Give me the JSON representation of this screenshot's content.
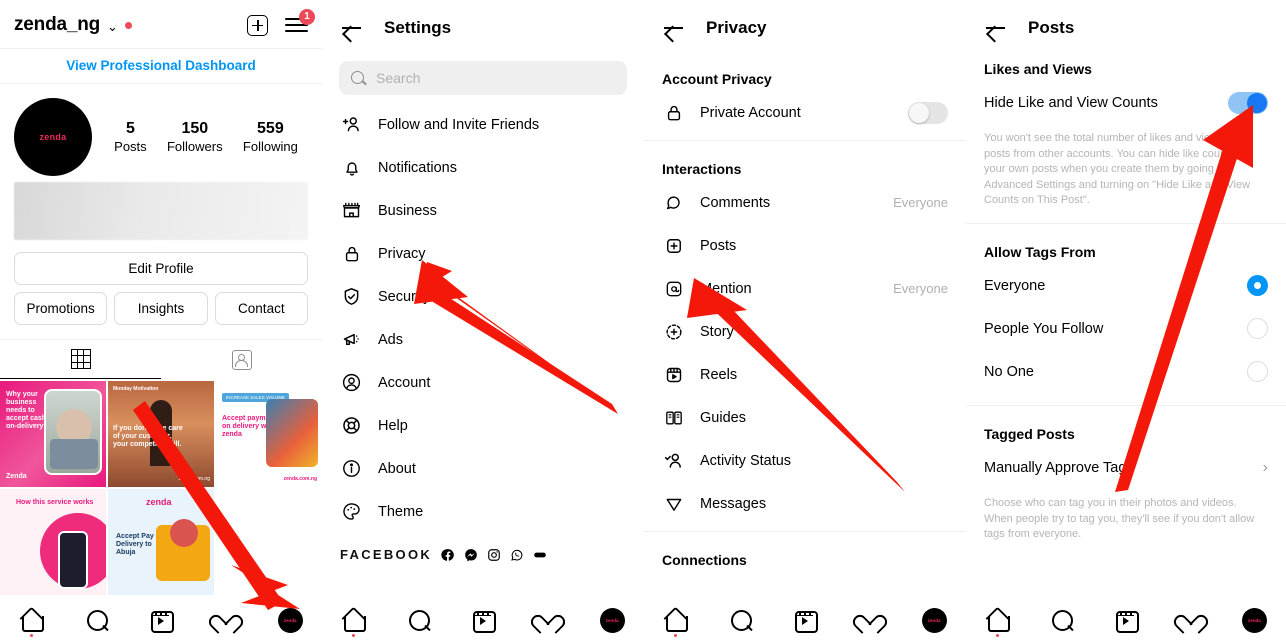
{
  "profile": {
    "username": "zenda_ng",
    "chevron": "⌄",
    "dashboard_link": "View Professional Dashboard",
    "avatar_text": "zenda",
    "notification_badge": "1",
    "stats": [
      {
        "num": "5",
        "label": "Posts"
      },
      {
        "num": "150",
        "label": "Followers"
      },
      {
        "num": "559",
        "label": "Following"
      }
    ],
    "edit_profile": "Edit Profile",
    "actions": [
      "Promotions",
      "Insights",
      "Contact"
    ],
    "photos": [
      {
        "title": "Why your business needs to accept cash-on-delivery?",
        "tag": "Zenda"
      },
      {
        "title": "If you don't take care of your customer, your competitor will.",
        "tag": "zenda.com.ng"
      },
      {
        "title": "Accept payment on delivery with zenda",
        "tag": "zenda.com.ng"
      },
      {
        "title": "How this service works",
        "tag": ""
      },
      {
        "title": "Accept Pay on Delivery to Abuja",
        "tag": "zenda"
      },
      {
        "title": "",
        "tag": ""
      }
    ]
  },
  "settings": {
    "title": "Settings",
    "search_placeholder": "Search",
    "items": [
      {
        "label": "Follow and Invite Friends",
        "icon": "add-person-icon"
      },
      {
        "label": "Notifications",
        "icon": "bell-icon"
      },
      {
        "label": "Business",
        "icon": "storefront-icon"
      },
      {
        "label": "Privacy",
        "icon": "lock-icon"
      },
      {
        "label": "Security",
        "icon": "shield-check-icon"
      },
      {
        "label": "Ads",
        "icon": "megaphone-icon"
      },
      {
        "label": "Account",
        "icon": "person-circle-icon"
      },
      {
        "label": "Help",
        "icon": "lifebuoy-icon"
      },
      {
        "label": "About",
        "icon": "info-circle-icon"
      },
      {
        "label": "Theme",
        "icon": "palette-icon"
      }
    ],
    "facebook_label": "FACEBOOK",
    "facebook_icons": [
      "facebook-icon",
      "messenger-icon",
      "instagram-icon",
      "whatsapp-icon",
      "portal-icon"
    ]
  },
  "privacy": {
    "title": "Privacy",
    "section_account": "Account Privacy",
    "private_account": {
      "label": "Private Account",
      "icon": "lock-icon",
      "state": "off"
    },
    "section_interactions": "Interactions",
    "interactions": [
      {
        "label": "Comments",
        "value": "Everyone",
        "icon": "comment-icon"
      },
      {
        "label": "Posts",
        "value": "",
        "icon": "plus-square-icon"
      },
      {
        "label": "Mention",
        "value": "Everyone",
        "icon": "at-icon"
      },
      {
        "label": "Story",
        "value": "",
        "icon": "story-plus-icon"
      },
      {
        "label": "Reels",
        "value": "",
        "icon": "reels-icon"
      },
      {
        "label": "Guides",
        "value": "",
        "icon": "guides-icon"
      },
      {
        "label": "Activity Status",
        "value": "",
        "icon": "activity-status-icon"
      },
      {
        "label": "Messages",
        "value": "",
        "icon": "paper-plane-icon"
      }
    ],
    "section_connections": "Connections"
  },
  "posts": {
    "title": "Posts",
    "section_likes": "Likes and Views",
    "hide_counts": {
      "label": "Hide Like and View Counts",
      "state": "on"
    },
    "hide_counts_helper": "You won't see the total number of likes and views on posts from other accounts. You can hide like counts on your own posts when you create them by going to Advanced Settings and turning on \"Hide Like and View Counts on This Post\".",
    "section_tags": "Allow Tags From",
    "tag_options": [
      {
        "label": "Everyone",
        "selected": true
      },
      {
        "label": "People You Follow",
        "selected": false
      },
      {
        "label": "No One",
        "selected": false
      }
    ],
    "section_tagged": "Tagged Posts",
    "manually_approve": "Manually Approve Tags",
    "tagged_helper": "Choose who can tag you in their photos and videos. When people try to tag you, they'll see if you don't allow tags from everyone."
  },
  "bottom_nav": {
    "items": [
      "home-icon",
      "search-icon",
      "reels-icon",
      "heart-icon",
      "profile-avatar"
    ],
    "avatar_text": "zenda"
  },
  "colors": {
    "accent_blue": "#0095F6",
    "toggle_on": "#1877F2",
    "red_dot": "#ED4956",
    "arrow_red": "#F91C0C",
    "brand_pink": "#ED2B5B"
  }
}
